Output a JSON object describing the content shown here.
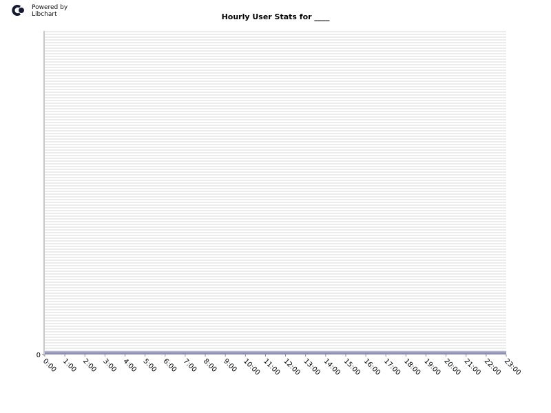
{
  "branding": {
    "line1": "Powered by",
    "line2": "Libchart",
    "logo_icon": "libchart-logo-icon"
  },
  "colors": {
    "plot_stripe_light": "#ffffff",
    "plot_stripe_dark": "#ececec",
    "axis_band": "#c8c8c8",
    "baseline_bar": "#8e8fb8",
    "baseline_bar_light": "#b4b5d2",
    "text": "#000000",
    "logo": "#141a33"
  },
  "chart_data": {
    "type": "bar",
    "title": "Hourly User Stats for ____",
    "xlabel": "",
    "ylabel": "",
    "categories": [
      "0:00",
      "1:00",
      "2:00",
      "3:00",
      "4:00",
      "5:00",
      "6:00",
      "7:00",
      "8:00",
      "9:00",
      "10:00",
      "11:00",
      "12:00",
      "13:00",
      "14:00",
      "15:00",
      "16:00",
      "17:00",
      "18:00",
      "19:00",
      "20:00",
      "21:00",
      "22:00",
      "23:00"
    ],
    "values": [
      0,
      0,
      0,
      0,
      0,
      0,
      0,
      0,
      0,
      0,
      0,
      0,
      0,
      0,
      0,
      0,
      0,
      0,
      0,
      0,
      0,
      0,
      0,
      0
    ],
    "y_ticks": [
      "0"
    ],
    "ylim": [
      0,
      0
    ],
    "grid": true,
    "legend": "none"
  }
}
